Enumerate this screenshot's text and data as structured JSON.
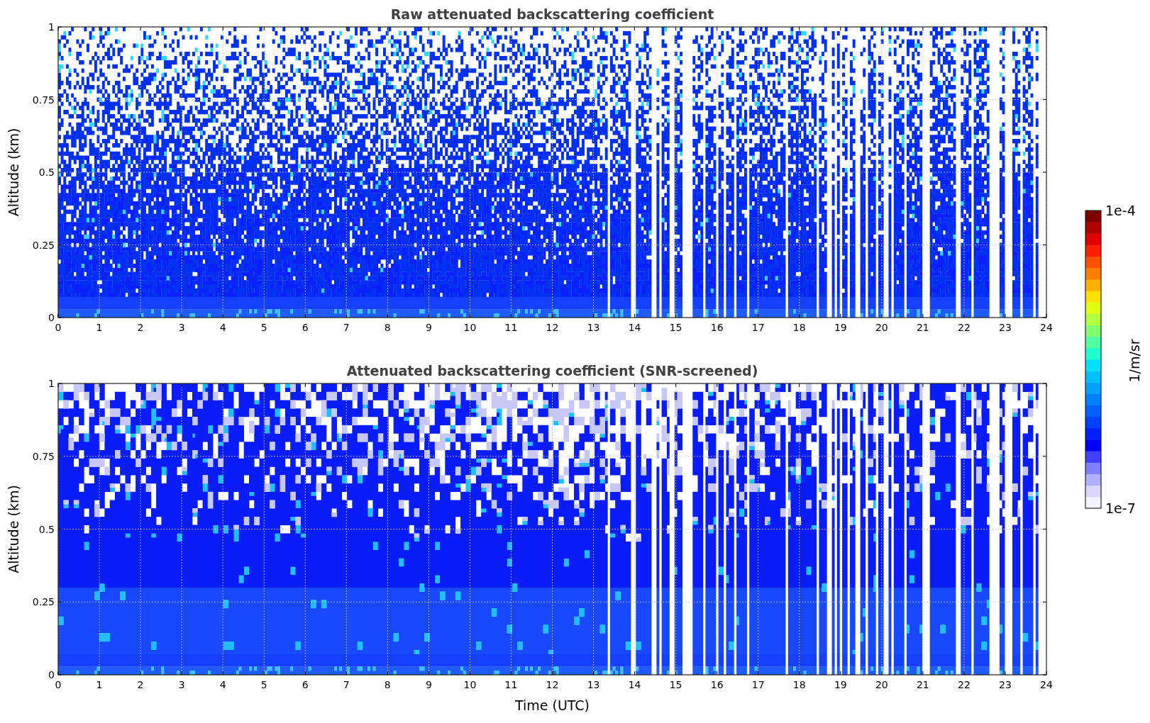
{
  "panels": [
    {
      "title": "Raw attenuated backscattering coefficient",
      "ylabel": "Altitude (km)",
      "yticks": [
        "1",
        "0.75",
        "0.5",
        "0.25",
        "0"
      ],
      "xticks": [
        "0",
        "1",
        "2",
        "3",
        "4",
        "5",
        "6",
        "7",
        "8",
        "9",
        "10",
        "11",
        "12",
        "13",
        "14",
        "15",
        "16",
        "17",
        "18",
        "19",
        "20",
        "21",
        "22",
        "23",
        "24"
      ],
      "kind": "raw"
    },
    {
      "title": "Attenuated backscattering coefficient (SNR-screened)",
      "ylabel": "Altitude (km)",
      "yticks": [
        "1",
        "0.75",
        "0.5",
        "0.25",
        "0"
      ],
      "xticks": [
        "0",
        "1",
        "2",
        "3",
        "4",
        "5",
        "6",
        "7",
        "8",
        "9",
        "10",
        "11",
        "12",
        "13",
        "14",
        "15",
        "16",
        "17",
        "18",
        "19",
        "20",
        "21",
        "22",
        "23",
        "24"
      ],
      "xlabel": "Time (UTC)",
      "kind": "screened"
    }
  ],
  "colorbar": {
    "max_label": "1e-4",
    "min_label": "1e-7",
    "unit": "1/m/sr"
  }
}
